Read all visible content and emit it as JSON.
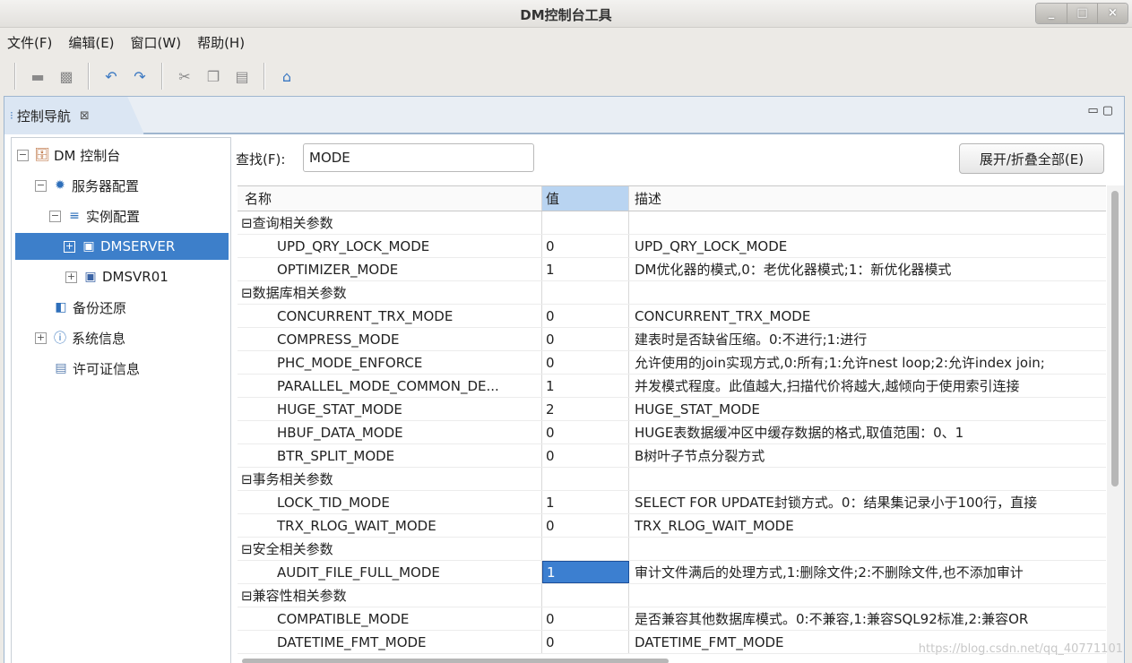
{
  "window": {
    "title": "DM控制台工具",
    "buttons": [
      "_",
      "□",
      "×"
    ]
  },
  "menu": [
    "文件(F)",
    "编辑(E)",
    "窗口(W)",
    "帮助(H)"
  ],
  "toolbar": {
    "icons": [
      "save-icon",
      "save-all-icon",
      "undo-icon",
      "redo-icon",
      "cut-icon",
      "copy-icon",
      "paste-icon",
      "home-icon"
    ]
  },
  "tab": {
    "label": "控制导航",
    "close": "⊠",
    "controls": "▭▢"
  },
  "tree": [
    {
      "label": "DM 控制台",
      "icon": "database-icon",
      "exp": "−",
      "level": 0
    },
    {
      "label": "服务器配置",
      "icon": "gear-icon",
      "exp": "−",
      "level": 1
    },
    {
      "label": "实例配置",
      "icon": "list-icon",
      "exp": "−",
      "level": 2
    },
    {
      "label": "DMSERVER",
      "icon": "ini-file-icon",
      "exp": "+",
      "level": 3,
      "selected": true
    },
    {
      "label": "DMSVR01",
      "icon": "ini-file-icon",
      "exp": "+",
      "level": 3
    },
    {
      "label": "备份还原",
      "icon": "backup-icon",
      "exp": "",
      "level": 1
    },
    {
      "label": "系统信息",
      "icon": "info-icon",
      "exp": "+",
      "level": 1
    },
    {
      "label": "许可证信息",
      "icon": "license-icon",
      "exp": "",
      "level": 1
    }
  ],
  "search": {
    "label": "查找(F):",
    "value": "MODE"
  },
  "expand_button": "展开/折叠全部(E)",
  "grid": {
    "headers": [
      "名称",
      "值",
      "描述"
    ],
    "rows": [
      {
        "group": true,
        "name": "⊟查询相关参数"
      },
      {
        "name": "UPD_QRY_LOCK_MODE",
        "value": "0",
        "desc": "UPD_QRY_LOCK_MODE"
      },
      {
        "name": "OPTIMIZER_MODE",
        "value": "1",
        "desc": "DM优化器的模式,0：老优化器模式;1：新优化器模式"
      },
      {
        "group": true,
        "name": "⊟数据库相关参数"
      },
      {
        "name": "CONCURRENT_TRX_MODE",
        "value": "0",
        "desc": "CONCURRENT_TRX_MODE"
      },
      {
        "name": "COMPRESS_MODE",
        "value": "0",
        "desc": "建表时是否缺省压缩。0:不进行;1:进行"
      },
      {
        "name": "PHC_MODE_ENFORCE",
        "value": "0",
        "desc": "允许使用的join实现方式,0:所有;1:允许nest loop;2:允许index join;"
      },
      {
        "name": "PARALLEL_MODE_COMMON_DE...",
        "value": "1",
        "desc": "并发模式程度。此值越大,扫描代价将越大,越倾向于使用索引连接"
      },
      {
        "name": "HUGE_STAT_MODE",
        "value": "2",
        "desc": "HUGE_STAT_MODE"
      },
      {
        "name": "HBUF_DATA_MODE",
        "value": "0",
        "desc": "HUGE表数据缓冲区中缓存数据的格式,取值范围：0、1"
      },
      {
        "name": "BTR_SPLIT_MODE",
        "value": "0",
        "desc": "B树叶子节点分裂方式"
      },
      {
        "group": true,
        "name": "⊟事务相关参数"
      },
      {
        "name": "LOCK_TID_MODE",
        "value": "1",
        "desc": "SELECT FOR UPDATE封锁方式。0：结果集记录小于100行，直接"
      },
      {
        "name": "TRX_RLOG_WAIT_MODE",
        "value": "0",
        "desc": "TRX_RLOG_WAIT_MODE"
      },
      {
        "group": true,
        "name": "⊟安全相关参数"
      },
      {
        "name": "AUDIT_FILE_FULL_MODE",
        "value": "1",
        "desc": "审计文件满后的处理方式,1:删除文件;2:不删除文件,也不添加审计",
        "selected_value": true
      },
      {
        "group": true,
        "name": "⊟兼容性相关参数"
      },
      {
        "name": "COMPATIBLE_MODE",
        "value": "0",
        "desc": "是否兼容其他数据库模式。0:不兼容,1:兼容SQL92标准,2:兼容OR"
      },
      {
        "name": "DATETIME_FMT_MODE",
        "value": "0",
        "desc": "DATETIME_FMT_MODE"
      }
    ]
  },
  "watermark": "https://blog.csdn.net/qq_40771101",
  "colors": {
    "selection": "#3d7fca",
    "tab_bg": "#dbe6f3",
    "value_header": "#b9d4f1"
  }
}
